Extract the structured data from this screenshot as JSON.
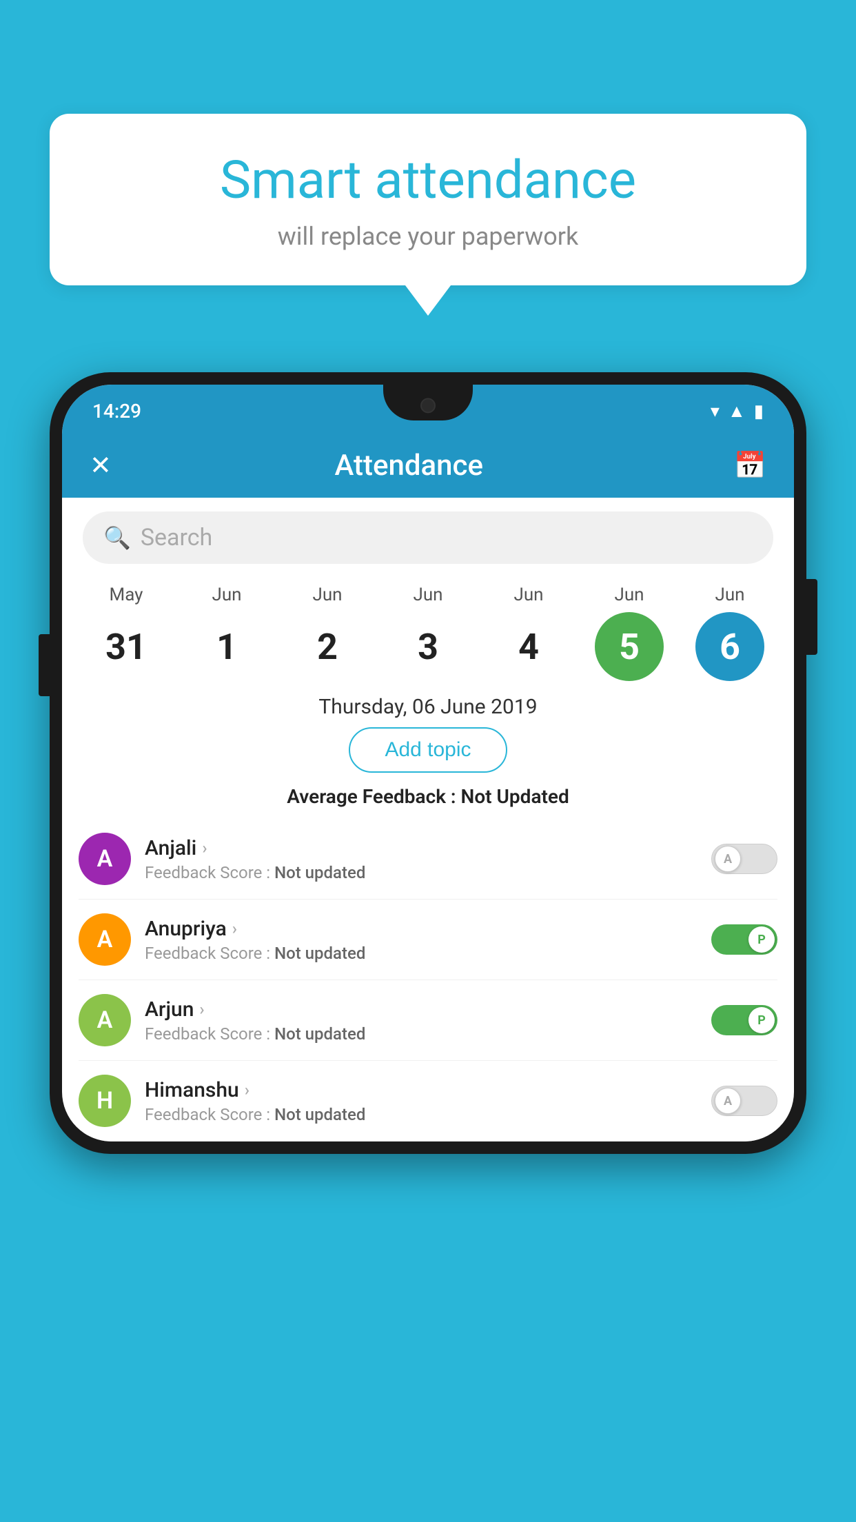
{
  "background": {
    "color": "#29b6d8"
  },
  "speech_bubble": {
    "title": "Smart attendance",
    "subtitle": "will replace your paperwork"
  },
  "phone": {
    "status_bar": {
      "time": "14:29",
      "icons": [
        "wifi",
        "signal",
        "battery"
      ]
    },
    "app_bar": {
      "title": "Attendance",
      "close_label": "×",
      "calendar_icon": "📅"
    },
    "search": {
      "placeholder": "Search"
    },
    "calendar": {
      "days": [
        {
          "month": "May",
          "day": "31",
          "state": "normal"
        },
        {
          "month": "Jun",
          "day": "1",
          "state": "normal"
        },
        {
          "month": "Jun",
          "day": "2",
          "state": "normal"
        },
        {
          "month": "Jun",
          "day": "3",
          "state": "normal"
        },
        {
          "month": "Jun",
          "day": "4",
          "state": "normal"
        },
        {
          "month": "Jun",
          "day": "5",
          "state": "today"
        },
        {
          "month": "Jun",
          "day": "6",
          "state": "selected"
        }
      ]
    },
    "selected_date": "Thursday, 06 June 2019",
    "add_topic_label": "Add topic",
    "avg_feedback_label": "Average Feedback :",
    "avg_feedback_value": "Not Updated",
    "students": [
      {
        "name": "Anjali",
        "initial": "A",
        "avatar_color": "#9c27b0",
        "feedback": "Not updated",
        "toggle": "off",
        "toggle_label": "A"
      },
      {
        "name": "Anupriya",
        "initial": "A",
        "avatar_color": "#ff9800",
        "feedback": "Not updated",
        "toggle": "on",
        "toggle_label": "P"
      },
      {
        "name": "Arjun",
        "initial": "A",
        "avatar_color": "#8bc34a",
        "feedback": "Not updated",
        "toggle": "on",
        "toggle_label": "P"
      },
      {
        "name": "Himanshu",
        "initial": "H",
        "avatar_color": "#8bc34a",
        "feedback": "Not updated",
        "toggle": "off",
        "toggle_label": "A"
      }
    ]
  }
}
